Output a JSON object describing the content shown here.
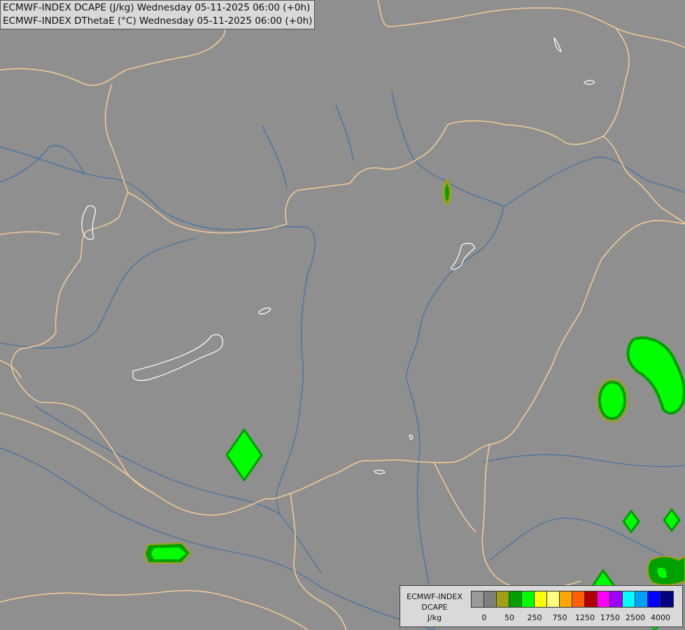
{
  "header": {
    "line1": "ECMWF-INDEX DCAPE (J/kg) Wednesday 05-11-2025 06:00 (+0h)",
    "line2": "ECMWF-INDEX DThetaE (°C) Wednesday 05-11-2025 06:00 (+0h)"
  },
  "colors": {
    "background": "#8f8f8f",
    "border_line": "#f0c896",
    "river_line": "#3a6ea5",
    "lake_line": "#ffffff"
  },
  "legend": {
    "title_line1": "ECMWF-INDEX",
    "title_line2": "DCAPE",
    "title_line3": "J/kg",
    "swatch_colors": [
      "#9a9a9a",
      "#7f7f7f",
      "#a0a010",
      "#00a000",
      "#00ff00",
      "#ffff00",
      "#ffff80",
      "#ffa500",
      "#ff6000",
      "#b00000",
      "#ff00ff",
      "#a000ff",
      "#00ffff",
      "#00a0ff",
      "#0000ff",
      "#000080"
    ],
    "tick_labels": [
      "0",
      "50",
      "250",
      "750",
      "1250",
      "1750",
      "2500",
      "4000"
    ]
  }
}
